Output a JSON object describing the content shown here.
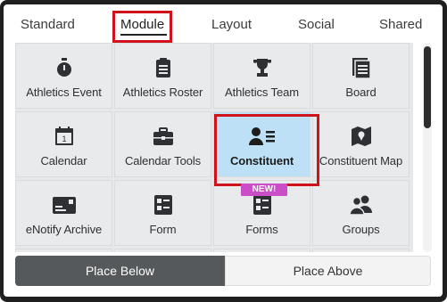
{
  "tabs": {
    "standard": "Standard",
    "module": "Module",
    "layout": "Layout",
    "social": "Social",
    "shared": "Shared",
    "active": "Module"
  },
  "tiles": [
    {
      "label": "Athletics Event",
      "icon": "stopwatch-icon"
    },
    {
      "label": "Athletics Roster",
      "icon": "clipboard-icon"
    },
    {
      "label": "Athletics Team",
      "icon": "trophy-icon"
    },
    {
      "label": "Board",
      "icon": "document-stack-icon"
    },
    {
      "label": "Calendar",
      "icon": "calendar-icon"
    },
    {
      "label": "Calendar Tools",
      "icon": "briefcase-icon"
    },
    {
      "label": "Constituent",
      "icon": "person-list-icon",
      "selected": true
    },
    {
      "label": "Constituent Map",
      "icon": "map-pin-icon"
    },
    {
      "label": "eNotify Archive",
      "icon": "card-icon"
    },
    {
      "label": "Form",
      "icon": "form-icon"
    },
    {
      "label": "Forms",
      "icon": "forms-icon",
      "badge": "NEW!"
    },
    {
      "label": "Groups",
      "icon": "group-icon"
    }
  ],
  "toggle": {
    "below": "Place Below",
    "above": "Place Above",
    "selected": "Place Below"
  },
  "colors": {
    "selected_tile": "#bde0f6",
    "highlight_box": "#d0121b",
    "new_badge": "#c94ec8",
    "active_toggle": "#55595c"
  }
}
